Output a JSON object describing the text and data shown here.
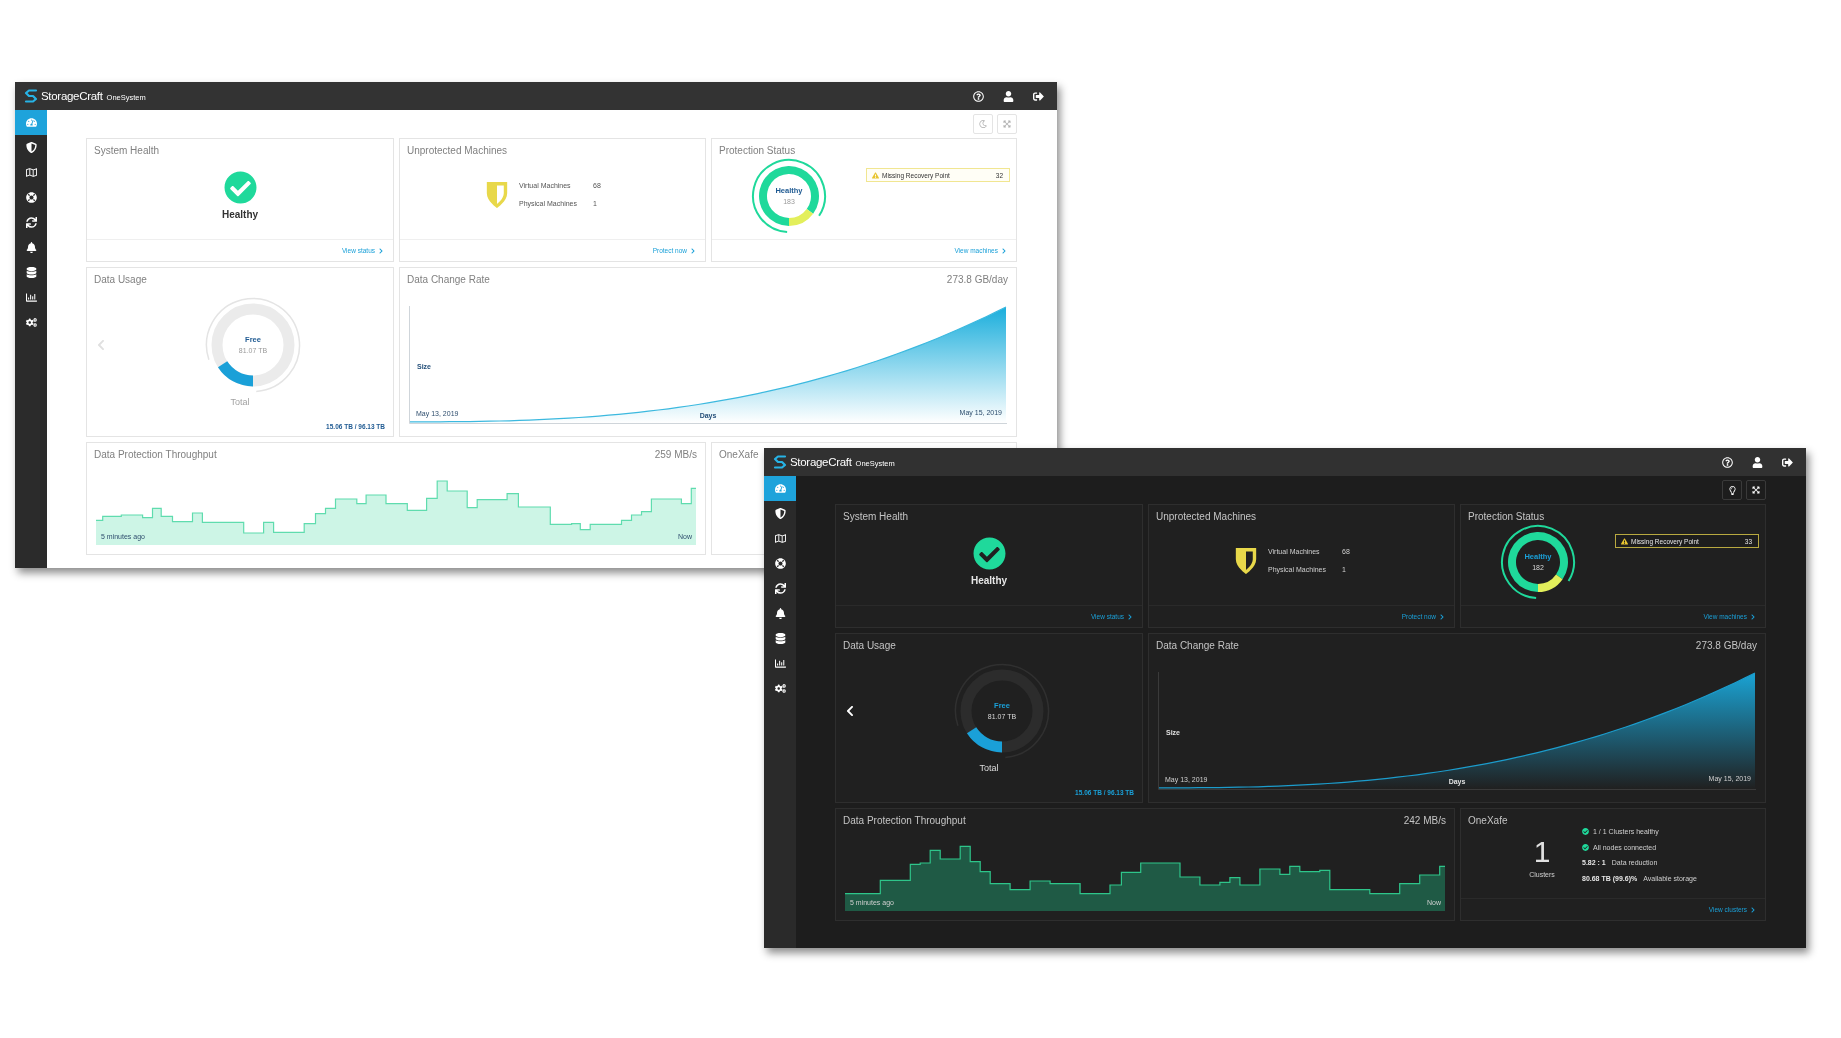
{
  "windows": [
    {
      "dark_mode": false,
      "brand": {
        "name": "StorageCraft",
        "product": "OneSystem"
      },
      "sidebar": [
        {
          "kind": "dashboard",
          "selected": true
        },
        {
          "kind": "shield",
          "selected": false
        },
        {
          "kind": "map",
          "selected": false
        },
        {
          "kind": "lifebuoy",
          "selected": false
        },
        {
          "kind": "sync",
          "selected": false
        },
        {
          "kind": "bell",
          "selected": false
        },
        {
          "kind": "database",
          "selected": false
        },
        {
          "kind": "chart",
          "selected": false
        },
        {
          "kind": "cogs",
          "selected": false
        }
      ],
      "system_health": {
        "title": "System Health",
        "status": "Healthy",
        "link": "View status"
      },
      "unprotected_machines": {
        "title": "Unprotected Machines",
        "rows": [
          {
            "label": "Virtual Machines",
            "value": "68"
          },
          {
            "label": "Physical Machines",
            "value": "1"
          }
        ],
        "link": "Protect now"
      },
      "protection_status": {
        "title": "Protection Status",
        "label": "Healthy",
        "value": "183",
        "chart_data": {
          "type": "donut",
          "values": [
            85.1,
            14.9
          ]
        },
        "alert": {
          "label": "Missing Recovery Point",
          "count": "32"
        },
        "link": "View machines"
      },
      "data_usage": {
        "title": "Data Usage",
        "label": "Free",
        "value": "81.07 TB",
        "level": 0.16,
        "caption": "Total",
        "summary": "15.06 TB / 96.13 TB"
      },
      "data_change_rate": {
        "title": "Data Change Rate",
        "value": "273.8 GB/day",
        "ylabel": "Size",
        "xlabel": "Days",
        "start": "May 13, 2019",
        "end": "May 15, 2019"
      },
      "throughput": {
        "title": "Data Protection Throughput",
        "value": "259 MB/s",
        "start": "5 minutes ago",
        "end": "Now"
      },
      "onexafe": {
        "title": "OneXafe"
      }
    },
    {
      "dark_mode": true,
      "brand": {
        "name": "StorageCraft",
        "product": "OneSystem"
      },
      "sidebar": [
        {
          "kind": "dashboard",
          "selected": true
        },
        {
          "kind": "shield",
          "selected": false
        },
        {
          "kind": "map",
          "selected": false
        },
        {
          "kind": "lifebuoy",
          "selected": false
        },
        {
          "kind": "sync",
          "selected": false
        },
        {
          "kind": "bell",
          "selected": false
        },
        {
          "kind": "database",
          "selected": false
        },
        {
          "kind": "chart",
          "selected": false
        },
        {
          "kind": "cogs",
          "selected": false
        }
      ],
      "system_health": {
        "title": "System Health",
        "status": "Healthy",
        "link": "View status"
      },
      "unprotected_machines": {
        "title": "Unprotected Machines",
        "rows": [
          {
            "label": "Virtual Machines",
            "value": "68"
          },
          {
            "label": "Physical Machines",
            "value": "1"
          }
        ],
        "link": "Protect now"
      },
      "protection_status": {
        "title": "Protection Status",
        "label": "Healthy",
        "value": "182",
        "chart_data": {
          "type": "donut",
          "values": [
            84.7,
            15.3
          ]
        },
        "alert": {
          "label": "Missing Recovery Point",
          "count": "33"
        },
        "link": "View machines"
      },
      "data_usage": {
        "title": "Data Usage",
        "label": "Free",
        "value": "81.07 TB",
        "level": 0.16,
        "caption": "Total",
        "summary": "15.06 TB / 96.13 TB"
      },
      "data_change_rate": {
        "title": "Data Change Rate",
        "value": "273.8 GB/day",
        "ylabel": "Size",
        "xlabel": "Days",
        "start": "May 13, 2019",
        "end": "May 15, 2019"
      },
      "throughput": {
        "title": "Data Protection Throughput",
        "value": "242 MB/s",
        "start": "5 minutes ago",
        "end": "Now"
      },
      "onexafe": {
        "title": "OneXafe",
        "count": "1",
        "count_label": "Clusters",
        "items": [
          {
            "kind": "check",
            "text": "1 / 1 Clusters healthy"
          },
          {
            "kind": "check",
            "text": "All nodes connected"
          },
          {
            "kind": "stat",
            "value": "5.82 : 1",
            "text": "Data reduction"
          },
          {
            "kind": "stat",
            "value": "80.68 TB (99.6)%",
            "text": "Available storage"
          }
        ],
        "link": "View clusters"
      }
    }
  ]
}
